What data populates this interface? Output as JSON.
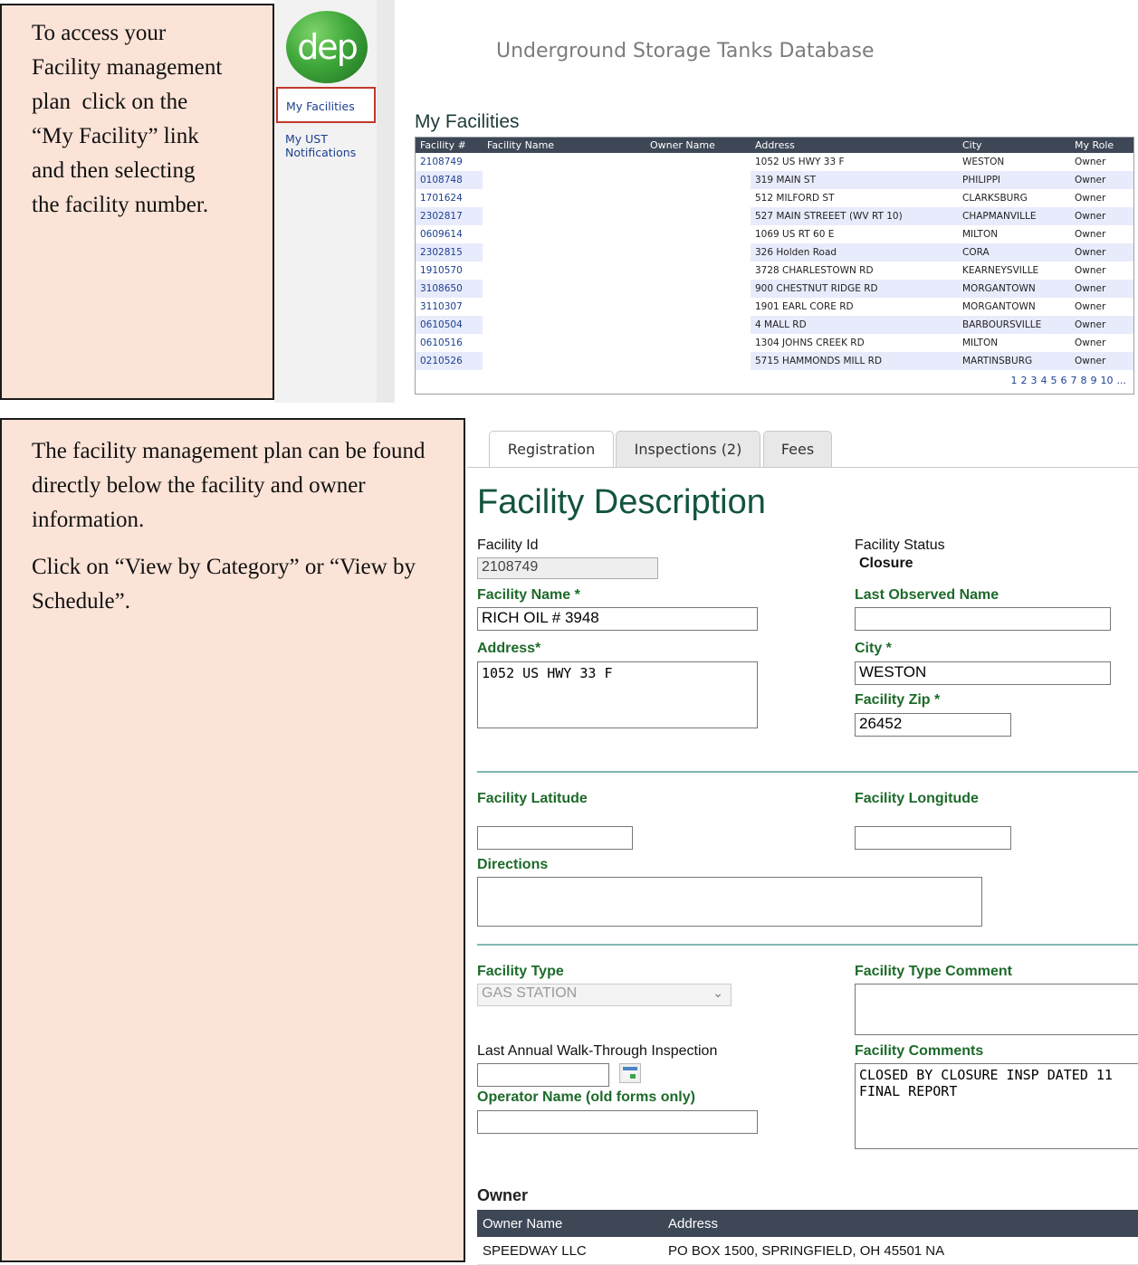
{
  "note_top": {
    "lines": [
      "To access your",
      "Facility management",
      "plan  click on the",
      "“My Facility” link",
      "and then selecting",
      "the facility number."
    ]
  },
  "note_bottom": {
    "para1": "The facility management plan can be found directly below the facility and owner information.",
    "para2": "Click on “View by Category” or “View by Schedule”."
  },
  "logo_text": "dep",
  "nav": {
    "my_facilities": "My Facilities",
    "my_ust_notifications_1": "My UST",
    "my_ust_notifications_2": "Notifications"
  },
  "app_title": "Underground Storage Tanks Database",
  "my_facilities": {
    "heading": "My Facilities",
    "columns": [
      "Facility #",
      "Facility Name",
      "Owner Name",
      "Address",
      "City",
      "My Role"
    ],
    "rows": [
      {
        "no": "2108749",
        "address": "1052 US HWY 33 F",
        "city": "WESTON",
        "role": "Owner"
      },
      {
        "no": "0108748",
        "address": "319 MAIN ST",
        "city": "PHILIPPI",
        "role": "Owner"
      },
      {
        "no": "1701624",
        "address": "512 MILFORD ST",
        "city": "CLARKSBURG",
        "role": "Owner"
      },
      {
        "no": "2302817",
        "address": "527 MAIN STREEET (WV RT 10)",
        "city": "CHAPMANVILLE",
        "role": "Owner"
      },
      {
        "no": "0609614",
        "address": "1069 US RT 60 E",
        "city": "MILTON",
        "role": "Owner"
      },
      {
        "no": "2302815",
        "address": "326 Holden Road",
        "city": "CORA",
        "role": "Owner"
      },
      {
        "no": "1910570",
        "address": "3728 CHARLESTOWN RD",
        "city": "KEARNEYSVILLE",
        "role": "Owner"
      },
      {
        "no": "3108650",
        "address": "900 CHESTNUT RIDGE RD",
        "city": "MORGANTOWN",
        "role": "Owner"
      },
      {
        "no": "3110307",
        "address": "1901 EARL CORE RD",
        "city": "MORGANTOWN",
        "role": "Owner"
      },
      {
        "no": "0610504",
        "address": "4 MALL RD",
        "city": "BARBOURSVILLE",
        "role": "Owner"
      },
      {
        "no": "0610516",
        "address": "1304 JOHNS CREEK RD",
        "city": "MILTON",
        "role": "Owner"
      },
      {
        "no": "0210526",
        "address": "5715 HAMMONDS MILL RD",
        "city": "MARTINSBURG",
        "role": "Owner"
      }
    ],
    "pages": [
      "1",
      "2",
      "3",
      "4",
      "5",
      "6",
      "7",
      "8",
      "9",
      "10",
      "..."
    ]
  },
  "tabs": [
    "Registration",
    "Inspections (2)",
    "Fees"
  ],
  "facility": {
    "title": "Facility Description",
    "facility_id_label": "Facility Id",
    "facility_id": "2108749",
    "facility_status_label": "Facility Status",
    "facility_status": "Closure",
    "facility_name_label": "Facility Name *",
    "facility_name": "RICH OIL # 3948",
    "last_observed_name_label": "Last Observed Name",
    "last_observed_name": "",
    "address_label": "Address*",
    "address": "1052 US HWY 33 F",
    "city_label": "City *",
    "city": "WESTON",
    "zip_label": "Facility Zip *",
    "zip": "26452",
    "latitude_label": "Facility Latitude",
    "latitude": "",
    "longitude_label": "Facility Longitude",
    "longitude": "",
    "directions_label": "Directions",
    "directions": "",
    "type_label": "Facility Type",
    "type": "GAS STATION",
    "type_comment_label": "Facility Type Comment",
    "type_comment": "",
    "walkthrough_label": "Last Annual Walk-Through Inspection",
    "walkthrough": "",
    "comments_label": "Facility Comments",
    "comments": "CLOSED BY CLOSURE INSP DATED 11\nFINAL REPORT",
    "operator_label": "Operator Name (old forms only)",
    "operator": ""
  },
  "owner": {
    "heading": "Owner",
    "columns": [
      "Owner Name",
      "Address"
    ],
    "rows": [
      {
        "name": "SPEEDWAY LLC",
        "address": "PO BOX 1500, SPRINGFIELD, OH 45501 NA"
      }
    ]
  },
  "colors": {
    "note_bg": "#fbe3d7",
    "header_dark": "#3d4756",
    "green_label": "#1d6a2a",
    "title_green": "#12543e",
    "link_blue": "#1c3f8f",
    "highlight_red": "#c0392b"
  }
}
